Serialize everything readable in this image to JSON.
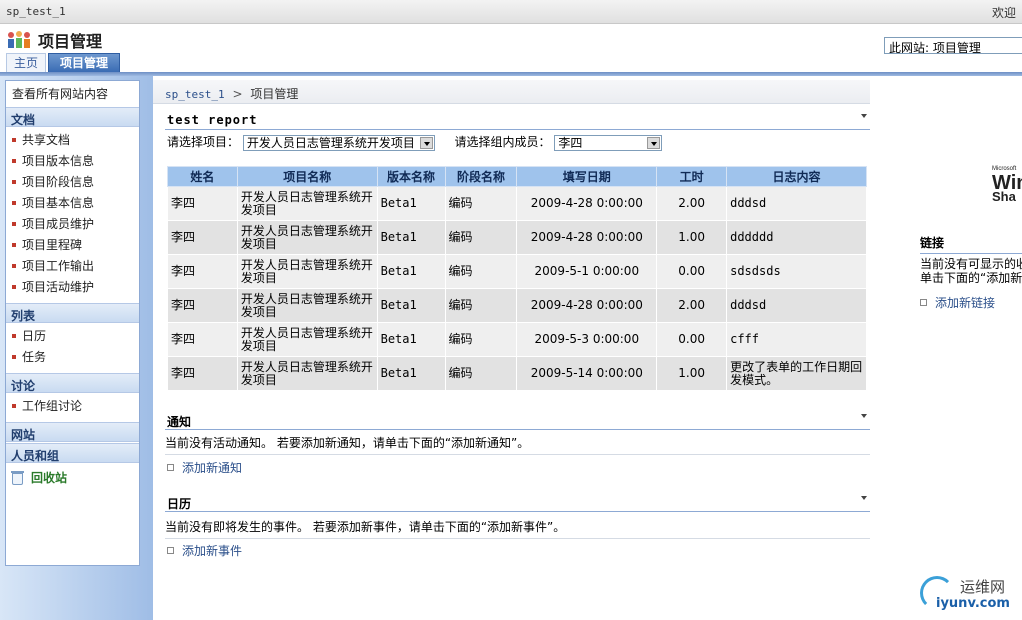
{
  "topbar": {
    "site_name": "sp_test_1",
    "welcome": "欢迎"
  },
  "header": {
    "title": "项目管理",
    "search_scope": "此网站: 项目管理",
    "tabs": [
      {
        "label": "主页",
        "active": false
      },
      {
        "label": "项目管理",
        "active": true
      }
    ]
  },
  "leftnav": {
    "view_all": "查看所有网站内容",
    "sections": {
      "docs": "文档",
      "lists": "列表",
      "discussions": "讨论",
      "sites": "网站",
      "people": "人员和组"
    },
    "doc_items": [
      "共享文档",
      "项目版本信息",
      "项目阶段信息",
      "项目基本信息",
      "项目成员维护",
      "项目里程碑",
      "项目工作输出",
      "项目活动维护"
    ],
    "list_items": [
      "日历",
      "任务"
    ],
    "discussion_items": [
      "工作组讨论"
    ],
    "recycle_bin": "回收站"
  },
  "breadcrumb": {
    "site": "sp_test_1",
    "sep": ">",
    "current": "项目管理"
  },
  "report": {
    "title": "test report",
    "project_label": "请选择项目：",
    "project_value": "开发人员日志管理系统开发项目",
    "member_label": "请选择组内成员：",
    "member_value": "李四",
    "columns": [
      "姓名",
      "项目名称",
      "版本名称",
      "阶段名称",
      "填写日期",
      "工时",
      "日志内容"
    ],
    "rows": [
      [
        "李四",
        "开发人员日志管理系统开发项目",
        "Beta1",
        "编码",
        "2009-4-28 0:00:00",
        "2.00",
        "dddsd"
      ],
      [
        "李四",
        "开发人员日志管理系统开发项目",
        "Beta1",
        "编码",
        "2009-4-28 0:00:00",
        "1.00",
        "dddddd"
      ],
      [
        "李四",
        "开发人员日志管理系统开发项目",
        "Beta1",
        "编码",
        "2009-5-1 0:00:00",
        "0.00",
        "sdsdsds"
      ],
      [
        "李四",
        "开发人员日志管理系统开发项目",
        "Beta1",
        "编码",
        "2009-4-28 0:00:00",
        "2.00",
        "dddsd"
      ],
      [
        "李四",
        "开发人员日志管理系统开发项目",
        "Beta1",
        "编码",
        "2009-5-3 0:00:00",
        "0.00",
        "cfff"
      ],
      [
        "李四",
        "开发人员日志管理系统开发项目",
        "Beta1",
        "编码",
        "2009-5-14 0:00:00",
        "1.00",
        "更改了表单的工作日期回发模式。"
      ]
    ]
  },
  "announcements": {
    "title": "通知",
    "empty_text": "当前没有活动通知。 若要添加新通知，请单击下面的“添加新通知”。",
    "add_link": "添加新通知"
  },
  "calendar": {
    "title": "日历",
    "empty_text": "当前没有即将发生的事件。 若要添加新事件，请单击下面的“添加新事件”。",
    "add_link": "添加新事件"
  },
  "right": {
    "logo_line1": "Microsoft",
    "logo_line2": "Win",
    "logo_line3": "Sha",
    "links_title": "链接",
    "links_text1": "当前没有可显示的收",
    "links_text2": "单击下面的“添加新",
    "links_add": "添加新链接"
  },
  "watermark": {
    "text1": "运维网",
    "text2": "iyunv.com"
  }
}
